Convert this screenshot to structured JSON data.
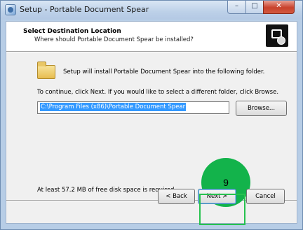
{
  "window": {
    "title": "Setup - Portable Document Spear",
    "controls": {
      "minimize": "–",
      "maximize": "□",
      "close": "✕"
    }
  },
  "header": {
    "title": "Select Destination Location",
    "subtitle": "Where should Portable Document Spear be installed?"
  },
  "body": {
    "info": "Setup will install Portable Document Spear into the following folder.",
    "instruction": "To continue, click Next. If you would like to select a different folder, click Browse.",
    "path_value": "C:\\Program Files (x86)\\Portable Document Spear",
    "browse_label": "Browse...",
    "disk_space": "At least 57.2 MB of free disk space is required."
  },
  "footer": {
    "back_label": "< Back",
    "next_label": "Next >",
    "cancel_label": "Cancel"
  },
  "annotation": {
    "step_number": "9",
    "color": "#13b34b"
  }
}
